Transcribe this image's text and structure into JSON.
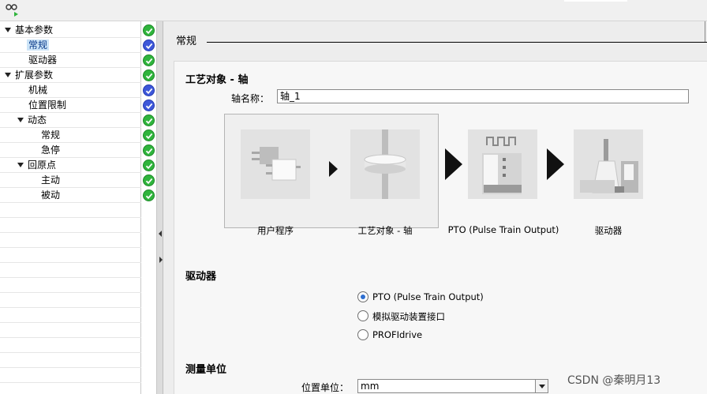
{
  "tree": {
    "items": [
      {
        "label": "基本参数",
        "level": 0,
        "expandable": true,
        "status": "green"
      },
      {
        "label": "常规",
        "level": 1,
        "expandable": false,
        "status": "blue",
        "selected": true
      },
      {
        "label": "驱动器",
        "level": 1,
        "expandable": false,
        "status": "green"
      },
      {
        "label": "扩展参数",
        "level": 0,
        "expandable": true,
        "status": "green"
      },
      {
        "label": "机械",
        "level": 1,
        "expandable": false,
        "status": "blue"
      },
      {
        "label": "位置限制",
        "level": 1,
        "expandable": false,
        "status": "blue"
      },
      {
        "label": "动态",
        "level": 1,
        "expandable": true,
        "status": "green"
      },
      {
        "label": "常规",
        "level": 2,
        "expandable": false,
        "status": "green"
      },
      {
        "label": "急停",
        "level": 2,
        "expandable": false,
        "status": "green"
      },
      {
        "label": "回原点",
        "level": 1,
        "expandable": true,
        "status": "green"
      },
      {
        "label": "主动",
        "level": 2,
        "expandable": false,
        "status": "green"
      },
      {
        "label": "被动",
        "level": 2,
        "expandable": false,
        "status": "green"
      }
    ]
  },
  "main": {
    "section_title": "常规",
    "tech_object_title": "工艺对象 - 轴",
    "axis_name_label": "轴名称：",
    "axis_name_value": "轴_1",
    "diagram": {
      "user_program": "用户程序",
      "tech_object": "工艺对象 - 轴",
      "pto": "PTO (Pulse Train Output)",
      "drive": "驱动器"
    },
    "drive_title": "驱动器",
    "drive_options": [
      {
        "label": "PTO (Pulse Train Output)",
        "checked": true
      },
      {
        "label": "模拟驱动装置接口",
        "checked": false
      },
      {
        "label": "PROFIdrive",
        "checked": false
      }
    ],
    "units_title": "测量单位",
    "position_unit_label": "位置单位：",
    "position_unit_value": "mm"
  },
  "watermark": "CSDN @秦明月13",
  "colors": {
    "status_green": "#2fb43c",
    "status_blue": "#3d57d9",
    "selection": "#cce4f7"
  }
}
